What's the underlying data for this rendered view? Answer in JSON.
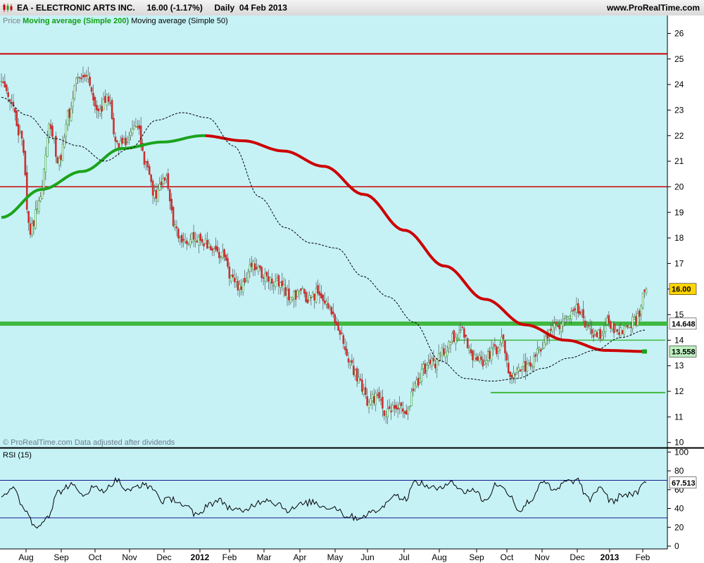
{
  "header": {
    "title": "EA - ELECTRONIC ARTS INC.     16.00 (-1.17%)     Daily  04 Feb 2013",
    "website": "www.ProRealTime.com"
  },
  "legend": {
    "price": "Price",
    "ma200": "Moving average (Simple 200)",
    "ma50": "Moving average (Simple 50)"
  },
  "footnote": "© ProRealTime.com  Data adjusted after dividends",
  "rsi": {
    "label": "RSI (15)"
  },
  "colors": {
    "background": "#c6f2f6",
    "ma200": "#1ca31c",
    "ma200_late": "#cc0000",
    "resistance": "#cc0000",
    "support": "#3fb83f",
    "candle_up": "#2e9a2e",
    "candle_down": "#cc3030"
  },
  "chart_data": [
    {
      "type": "candlestick",
      "title": "EA - ELECTRONIC ARTS INC.",
      "ylim": [
        9.8,
        26.7
      ],
      "y_ticks": [
        10,
        11,
        12,
        13,
        14,
        15,
        16,
        17,
        18,
        19,
        20,
        21,
        22,
        23,
        24,
        25,
        26
      ],
      "x_ticks": [
        "Aug",
        "Sep",
        "Oct",
        "Nov",
        "Dec",
        "2012",
        "Feb",
        "Mar",
        "Apr",
        "May",
        "Jun",
        "Jul",
        "Aug",
        "Sep",
        "Oct",
        "Nov",
        "Dec",
        "2013",
        "Feb"
      ],
      "last_price": "16.00",
      "price_keypoints": [
        24,
        23.5,
        22,
        18.3,
        19.5,
        22.4,
        21.0,
        22.9,
        24.5,
        24.2,
        22.8,
        23.5,
        21.7,
        21.8,
        22.5,
        21.0,
        19.6,
        20.4,
        18.4,
        17.8,
        18.0,
        17.8,
        17.5,
        17.4,
        16.3,
        16.1,
        17.0,
        16.6,
        16.4,
        16.2,
        15.6,
        15.9,
        15.6,
        15.9,
        15.4,
        14.5,
        13.2,
        12.6,
        11.6,
        11.8,
        11.2,
        11.5,
        11.0,
        12.3,
        12.9,
        13.1,
        13.6,
        14.1,
        14.3,
        13.3,
        13.2,
        13.5,
        13.9,
        12.6,
        12.9,
        13.1,
        13.6,
        14.4,
        14.6,
        15.1,
        15.2,
        14.4,
        14.2,
        14.7,
        14.3,
        14.6,
        14.8,
        16.0
      ],
      "series": [
        {
          "name": "Moving average (Simple 200)",
          "keypoints": [
            18.8,
            19.9,
            20.6,
            21.5,
            21.75,
            22.0,
            21.8,
            21.4,
            20.8,
            19.7,
            18.3,
            16.9,
            15.6,
            14.6,
            14.0,
            13.6,
            13.558
          ],
          "last_value": "13.558"
        },
        {
          "name": "Moving average (Simple 50)",
          "keypoints": [
            23.5,
            22.8,
            21.9,
            21.6,
            21.0,
            21.5,
            22.6,
            22.9,
            22.7,
            21.6,
            19.6,
            18.4,
            17.8,
            17.6,
            16.5,
            15.7,
            14.7,
            13.2,
            12.5,
            12.4,
            12.5,
            12.9,
            13.3,
            13.6,
            14.1,
            14.4
          ]
        }
      ],
      "horizontal_lines": [
        {
          "value": 25.2,
          "kind": "resistance"
        },
        {
          "value": 20.0,
          "kind": "resistance"
        },
        {
          "value": 14.648,
          "kind": "support",
          "label": "14.648"
        },
        {
          "value": 14.0,
          "kind": "support"
        },
        {
          "value": 11.95,
          "kind": "support"
        }
      ]
    },
    {
      "type": "line",
      "title": "RSI (15)",
      "ylim": [
        -3,
        104
      ],
      "y_ticks": [
        0,
        20,
        40,
        60,
        80,
        100
      ],
      "reference_lines": [
        70,
        30
      ],
      "last_value": "67.513",
      "rsi_keypoints": [
        55,
        60,
        40,
        20,
        32,
        58,
        65,
        55,
        62,
        60,
        70,
        58,
        65,
        63,
        48,
        50,
        42,
        32,
        45,
        48,
        40,
        36,
        45,
        50,
        45,
        38,
        44,
        47,
        42,
        41,
        32,
        30,
        35,
        40,
        55,
        50,
        68,
        64,
        60,
        70,
        58,
        60,
        48,
        66,
        57,
        38,
        49,
        70,
        58,
        68,
        70,
        49,
        63,
        47,
        55,
        55,
        67.5
      ]
    }
  ]
}
